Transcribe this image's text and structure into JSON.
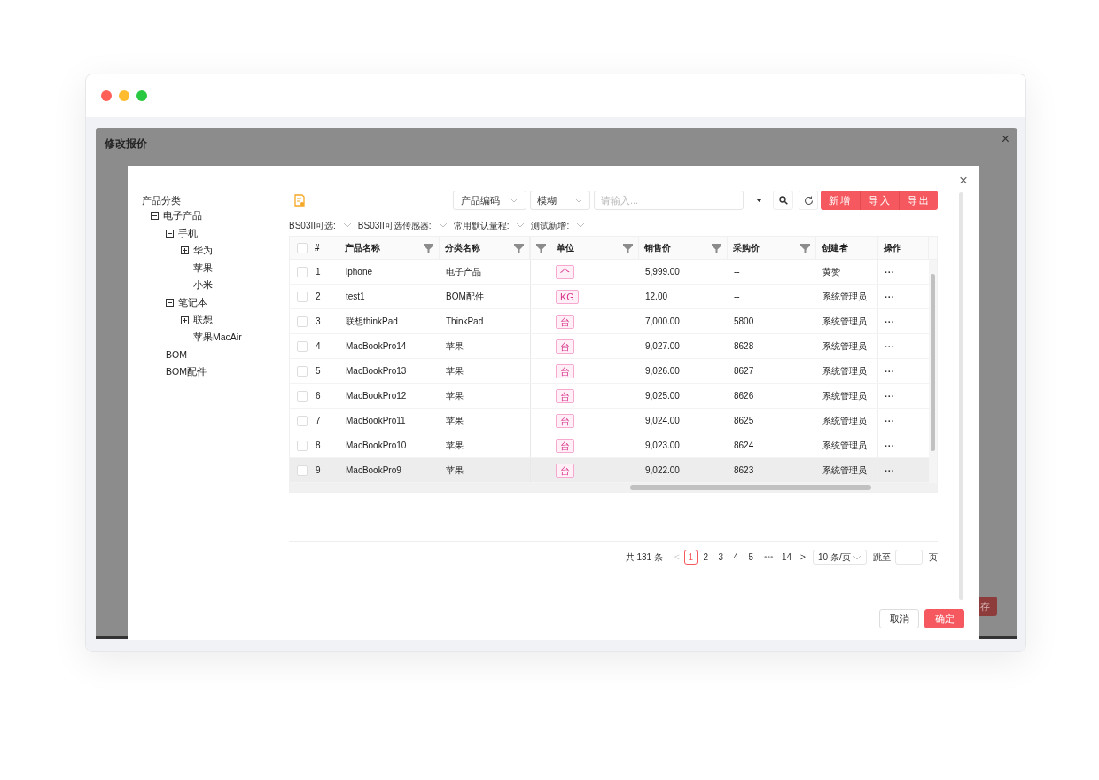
{
  "background_dialog": {
    "title": "修改报价",
    "close": "×",
    "save_button": "存"
  },
  "dialog": {
    "close": "×",
    "tree": {
      "title": "产品分类",
      "items": [
        {
          "label": "电子产品",
          "expanded": true,
          "children": [
            {
              "label": "手机",
              "expanded": true,
              "children": [
                {
                  "label": "华为",
                  "expanded": false
                },
                {
                  "label": "苹果"
                },
                {
                  "label": "小米"
                }
              ]
            },
            {
              "label": "笔记本",
              "expanded": true,
              "children": [
                {
                  "label": "联想",
                  "expanded": false
                },
                {
                  "label": "苹果MacAir"
                }
              ]
            },
            {
              "label": "BOM"
            },
            {
              "label": "BOM配件"
            }
          ]
        }
      ]
    },
    "toolbar": {
      "field_select": "产品编码",
      "match_select": "模糊",
      "search": {
        "placeholder": "请输入..."
      },
      "buttons": [
        "新增",
        "导入",
        "导出"
      ]
    },
    "filters": [
      "BS03II可选:",
      "BS03II可选传感器:",
      "常用默认量程:",
      "测试新增:"
    ],
    "table": {
      "header_checked": false,
      "columns": [
        {
          "label": "#",
          "filter": false
        },
        {
          "label": "产品名称",
          "filter": true
        },
        {
          "label": "分类名称",
          "filter": true
        },
        {
          "label": "单位",
          "filter": true,
          "leading_filter": true
        },
        {
          "label": "销售价",
          "filter": true
        },
        {
          "label": "采购价",
          "filter": true
        },
        {
          "label": "创建者",
          "filter": false
        },
        {
          "label": "操作",
          "filter": false
        }
      ],
      "rows": [
        {
          "checked": false,
          "highlighted": false,
          "cells": [
            "1",
            "iphone",
            "电子产品",
            "个",
            "5,999.00",
            "--",
            "黄赞",
            "···"
          ]
        },
        {
          "checked": false,
          "highlighted": false,
          "cells": [
            "2",
            "test1",
            "BOM配件",
            "KG",
            "12.00",
            "--",
            "系统管理员",
            "···"
          ]
        },
        {
          "checked": false,
          "highlighted": false,
          "cells": [
            "3",
            "联想thinkPad",
            "ThinkPad",
            "台",
            "7,000.00",
            "5800",
            "系统管理员",
            "···"
          ]
        },
        {
          "checked": false,
          "highlighted": false,
          "cells": [
            "4",
            "MacBookPro14",
            "苹果",
            "台",
            "9,027.00",
            "8628",
            "系统管理员",
            "···"
          ]
        },
        {
          "checked": false,
          "highlighted": false,
          "cells": [
            "5",
            "MacBookPro13",
            "苹果",
            "台",
            "9,026.00",
            "8627",
            "系统管理员",
            "···"
          ]
        },
        {
          "checked": false,
          "highlighted": false,
          "cells": [
            "6",
            "MacBookPro12",
            "苹果",
            "台",
            "9,025.00",
            "8626",
            "系统管理员",
            "···"
          ]
        },
        {
          "checked": false,
          "highlighted": false,
          "cells": [
            "7",
            "MacBookPro11",
            "苹果",
            "台",
            "9,024.00",
            "8625",
            "系统管理员",
            "···"
          ]
        },
        {
          "checked": false,
          "highlighted": false,
          "cells": [
            "8",
            "MacBookPro10",
            "苹果",
            "台",
            "9,023.00",
            "8624",
            "系统管理员",
            "···"
          ]
        },
        {
          "checked": false,
          "highlighted": true,
          "cells": [
            "9",
            "MacBookPro9",
            "苹果",
            "台",
            "9,022.00",
            "8623",
            "系统管理员",
            "···"
          ]
        }
      ]
    },
    "pagination": {
      "total": "共 131 条",
      "prev": "<",
      "pages": [
        {
          "label": "1",
          "selected": true
        },
        {
          "label": "2",
          "selected": false
        },
        {
          "label": "3",
          "selected": false
        },
        {
          "label": "4",
          "selected": false
        },
        {
          "label": "5",
          "selected": false
        },
        {
          "label": "•••",
          "kind": "gap",
          "selected": false
        },
        {
          "label": "14",
          "selected": false
        }
      ],
      "next": ">",
      "page_size": "10 条/页",
      "jump_label": "跳至",
      "page_suffix": "页"
    },
    "footer_buttons": [
      {
        "label": "取消",
        "kind": "default"
      },
      {
        "label": "确定",
        "kind": "primary"
      }
    ]
  }
}
